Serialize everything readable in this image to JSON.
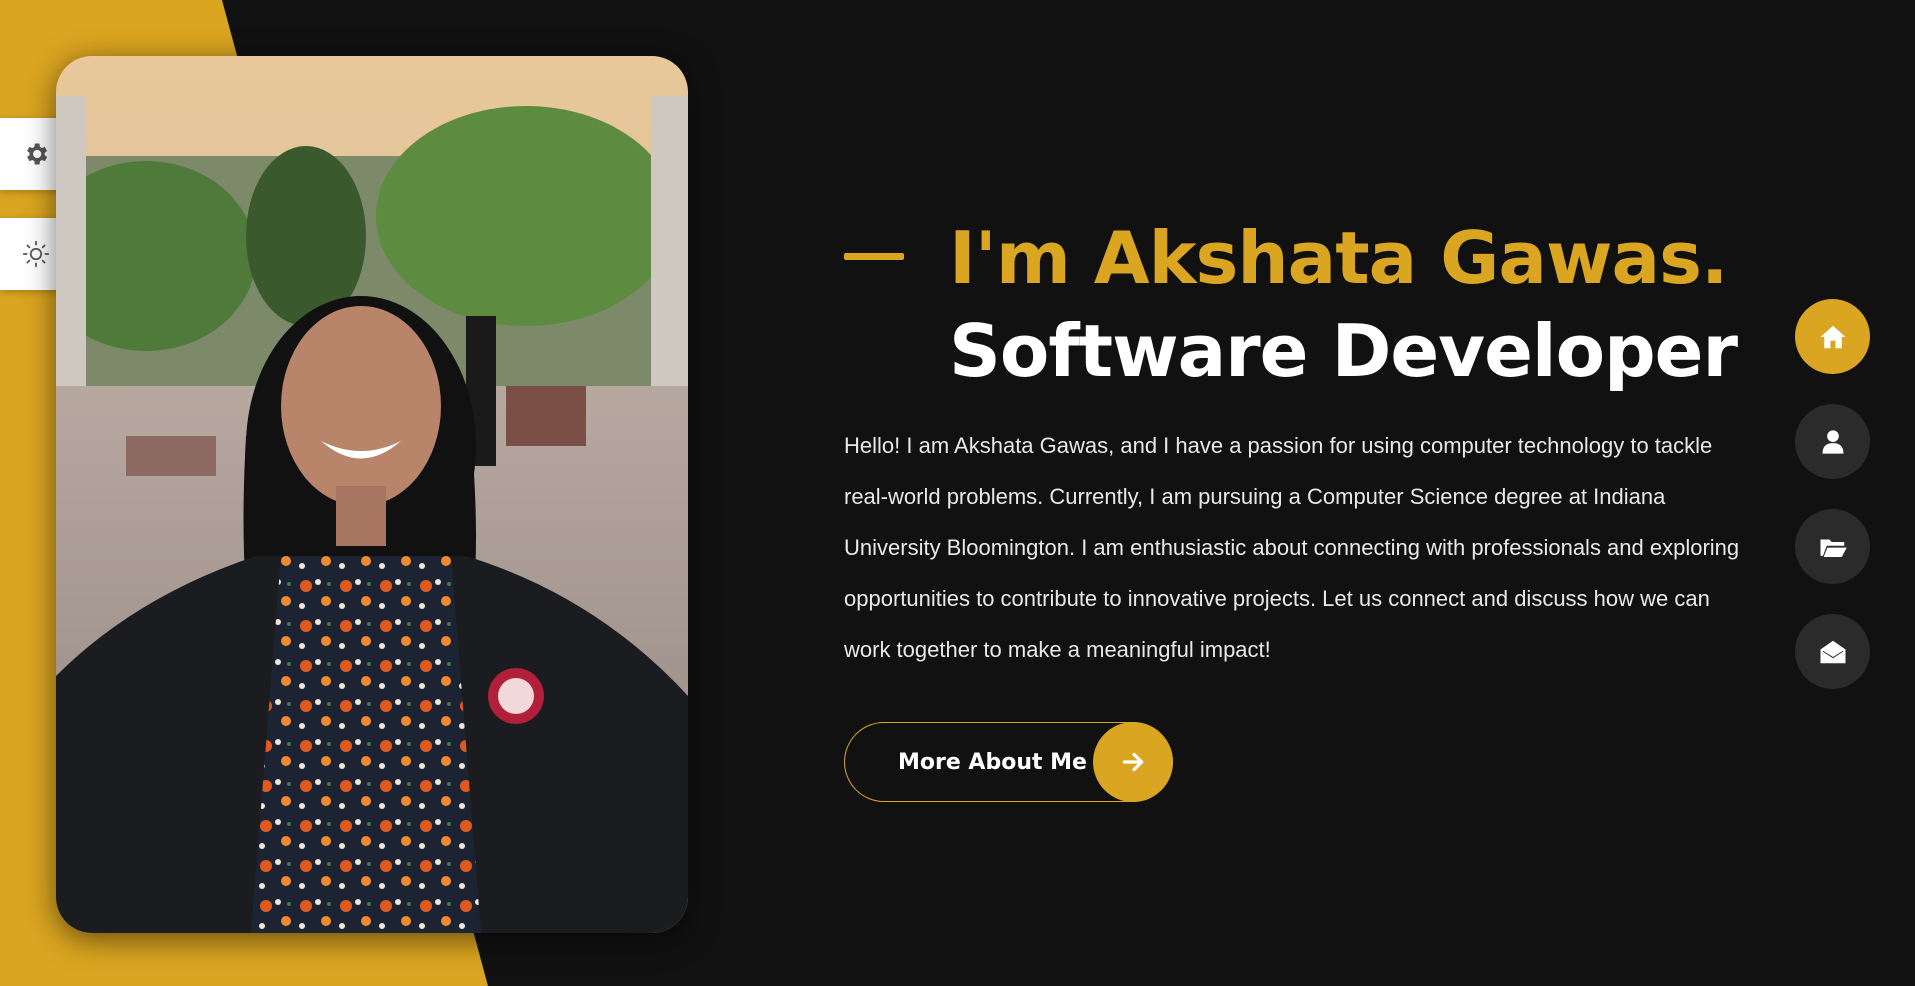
{
  "theme": {
    "accent": "#daa520",
    "background": "#111111",
    "nav_button": "#2b2b2b"
  },
  "sidebar": {
    "items": [
      {
        "icon": "gear-icon"
      },
      {
        "icon": "sun-icon"
      }
    ]
  },
  "hero": {
    "name": "I'm Akshata Gawas.",
    "role": "Software Developer",
    "intro": "Hello! I am Akshata Gawas, and I have a passion for using computer technology to tackle real-world problems. Currently, I am pursuing a Computer Science degree at Indiana University Bloomington. I am enthusiastic about connecting with professionals and exploring opportunities to contribute to innovative projects. Let us connect and discuss how we can work together to make a meaningful impact!",
    "cta_label": "More About Me",
    "cta_icon": "arrow-right-icon"
  },
  "nav": {
    "items": [
      {
        "icon": "home-icon",
        "active": true
      },
      {
        "icon": "user-icon",
        "active": false
      },
      {
        "icon": "folder-open-icon",
        "active": false
      },
      {
        "icon": "envelope-open-icon",
        "active": false
      }
    ]
  }
}
